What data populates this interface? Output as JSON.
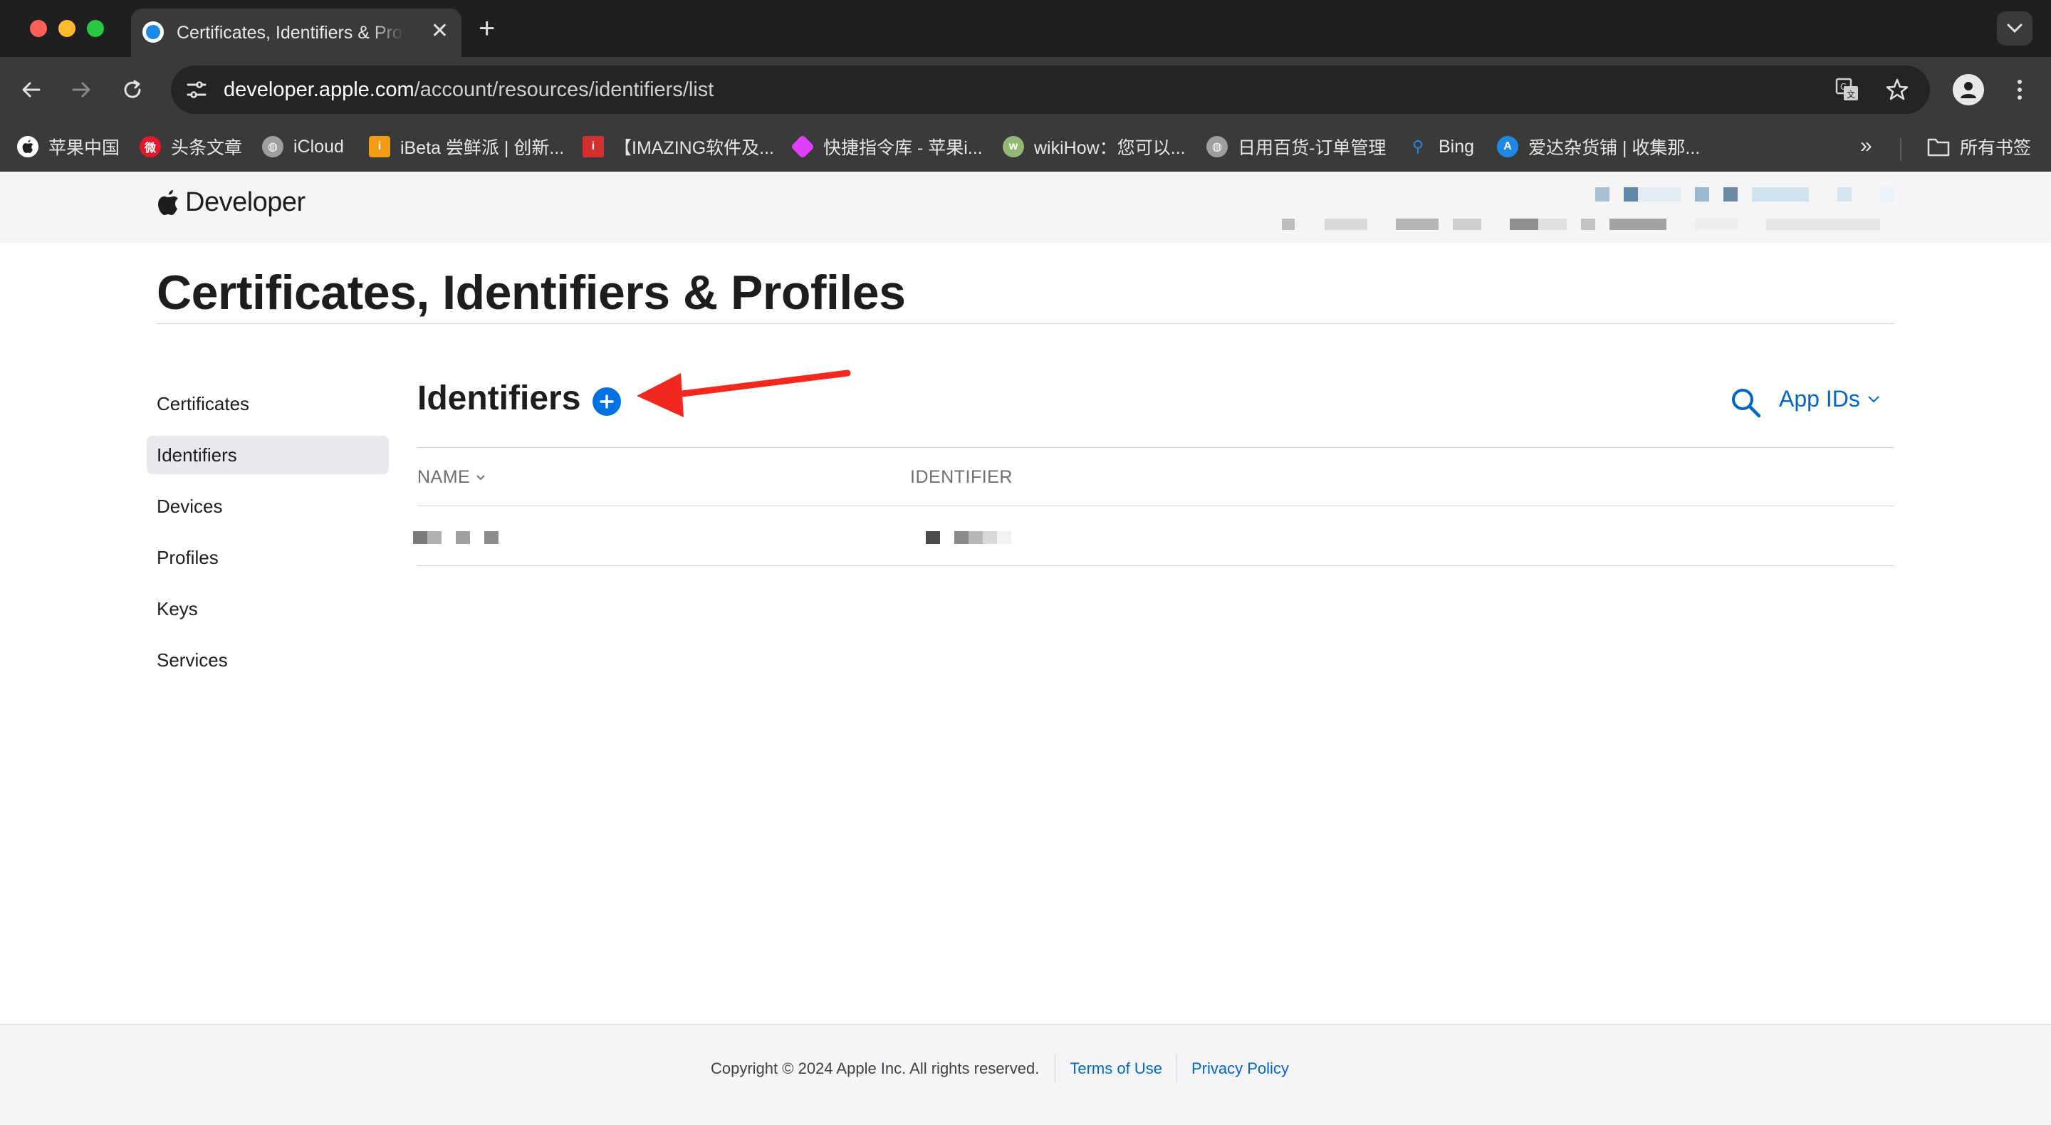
{
  "browser": {
    "tab_title": "Certificates, Identifiers & Profiles",
    "url_domain": "developer.apple.com",
    "url_path": "/account/resources/identifiers/list",
    "bookmarks": [
      {
        "label": "苹果中国",
        "icon": "apple-icon",
        "color": "#ffffff"
      },
      {
        "label": "头条文章",
        "icon": "weibo-icon",
        "color": "#e6162d"
      },
      {
        "label": "iCloud",
        "icon": "globe-icon",
        "color": "#9e9e9e"
      },
      {
        "label": "iBeta 尝鲜派 | 创新...",
        "icon": "ibeta-icon",
        "color": "#f39c12"
      },
      {
        "label": "【IMAZING软件及...",
        "icon": "imazing-icon",
        "color": "#d32f2f"
      },
      {
        "label": "快捷指令库 - 苹果i...",
        "icon": "shortcuts-icon",
        "color": "#e040fb"
      },
      {
        "label": "wikiHow：您可以...",
        "icon": "wikihow-icon",
        "color": "#93b874"
      },
      {
        "label": "日用百货-订单管理",
        "icon": "globe-icon",
        "color": "#9e9e9e"
      },
      {
        "label": "Bing",
        "icon": "search-icon",
        "color": "#1e88e5"
      },
      {
        "label": "爱达杂货铺 | 收集那...",
        "icon": "appstore-icon",
        "color": "#1e88e5"
      }
    ],
    "all_bookmarks_label": "所有书签"
  },
  "header": {
    "brand": "Developer"
  },
  "page": {
    "title": "Certificates, Identifiers & Profiles"
  },
  "sidebar": {
    "items": [
      {
        "label": "Certificates",
        "active": false
      },
      {
        "label": "Identifiers",
        "active": true
      },
      {
        "label": "Devices",
        "active": false
      },
      {
        "label": "Profiles",
        "active": false
      },
      {
        "label": "Keys",
        "active": false
      },
      {
        "label": "Services",
        "active": false
      }
    ]
  },
  "main": {
    "section_title": "Identifiers",
    "filter_label": "App IDs",
    "columns": [
      "NAME",
      "IDENTIFIER"
    ]
  },
  "footer": {
    "copyright": "Copyright © 2024 Apple Inc. All rights reserved.",
    "terms": "Terms of Use",
    "privacy": "Privacy Policy"
  },
  "colors": {
    "accent": "#0071e3",
    "link": "#0066cc",
    "annotation_arrow": "#f2281f"
  }
}
